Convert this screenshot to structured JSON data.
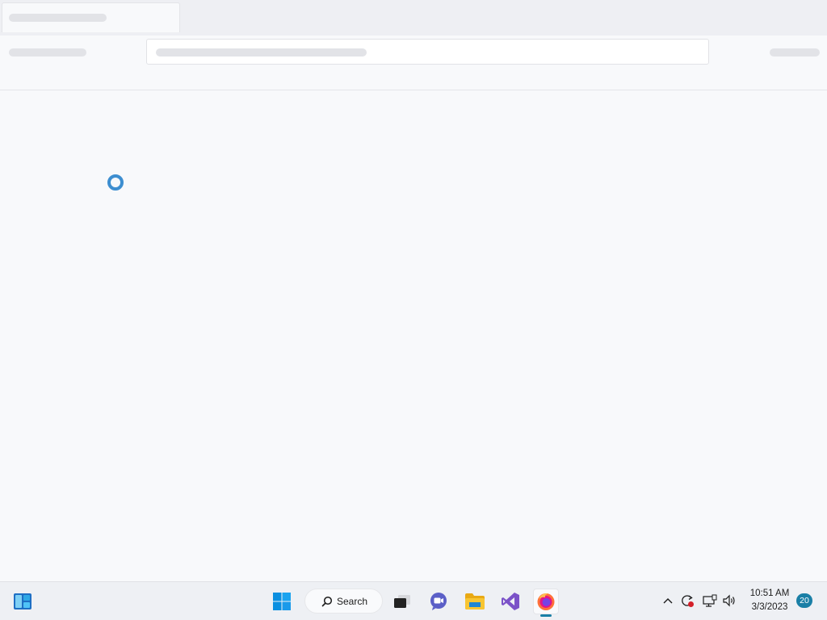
{
  "taskbar": {
    "search_label": "Search",
    "pinned_icons": [
      "widgets-icon",
      "start-icon",
      "search-icon",
      "task-view-icon",
      "teams-chat-icon",
      "file-explorer-icon",
      "visual-studio-icon",
      "firefox-icon"
    ],
    "active_app": "firefox-icon",
    "tray": {
      "icons": [
        "show-hidden-icons-icon",
        "sync-alert-icon",
        "network-icon",
        "volume-icon"
      ],
      "time": "10:51 AM",
      "date": "3/3/2023",
      "notification_count": "20"
    }
  },
  "colors": {
    "accent": "#1a7fa6",
    "spinner": "#3d8ed0",
    "skeleton": "#e2e3e7"
  }
}
